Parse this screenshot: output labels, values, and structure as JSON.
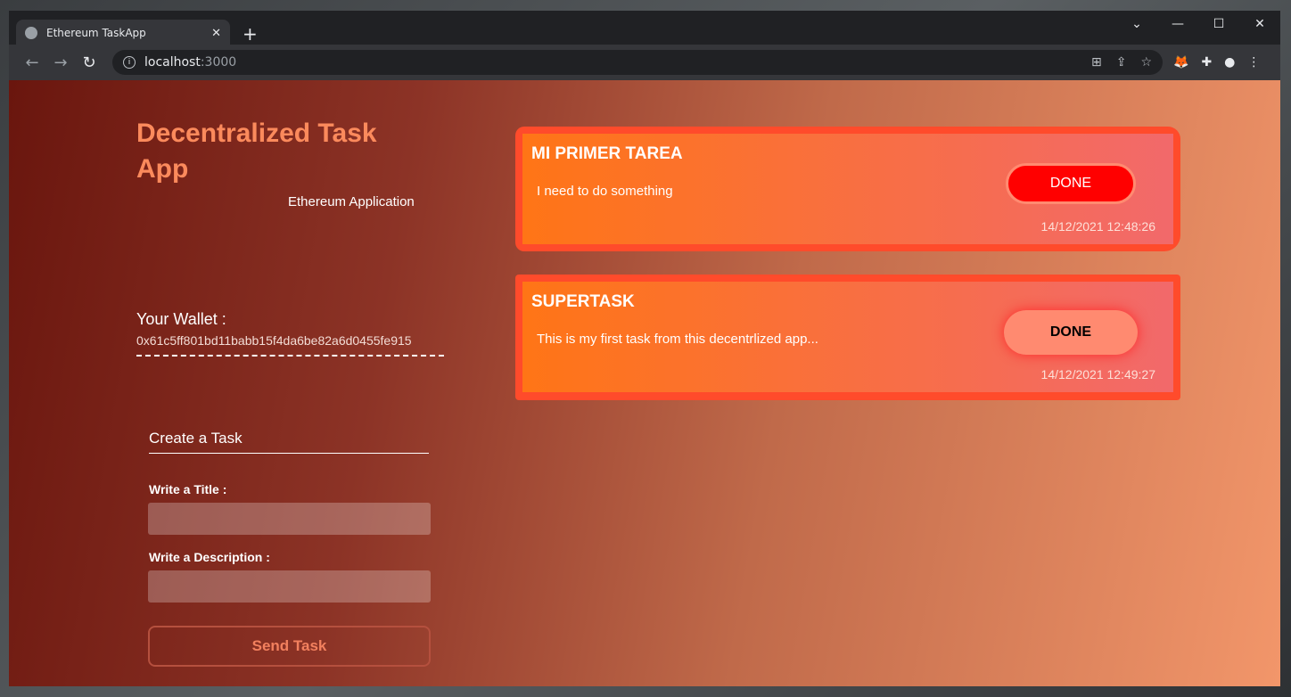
{
  "browser": {
    "tab_title": "Ethereum TaskApp",
    "url_host": "localhost",
    "url_port": ":3000",
    "icons": [
      "globe-icon",
      "close-icon",
      "plus-icon",
      "chevron-down-icon",
      "minimize-icon",
      "maximize-icon",
      "window-close-icon",
      "back-icon",
      "forward-icon",
      "reload-icon",
      "info-icon",
      "translate-icon",
      "share-icon",
      "star-icon",
      "metamask-icon",
      "extensions-icon",
      "profile-icon",
      "menu-icon"
    ]
  },
  "app": {
    "title": "Decentralized Task App",
    "subtitle": "Ethereum Application",
    "wallet_label": "Your Wallet :",
    "wallet_address": "0x61c5ff801bd11babb15f4da6be82a6d0455fe915",
    "form": {
      "heading": "Create a Task",
      "title_label": "Write a Title :",
      "title_value": "",
      "description_label": "Write a Description :",
      "description_value": "",
      "submit": "Send Task"
    }
  },
  "tasks": [
    {
      "title": "MI PRIMER TAREA",
      "description": "I need to do something",
      "button": "DONE",
      "date": "14/12/2021 12:48:26"
    },
    {
      "title": "SUPERTASK",
      "description": "This is my first task from this decentrlized app...",
      "button": "DONE",
      "date": "14/12/2021 12:49:27"
    }
  ],
  "colors": {
    "card_border": "#ff4b2b",
    "done_active": "#ff0000",
    "done_inactive": "#ff8a70",
    "title": "#fb8a5c"
  }
}
